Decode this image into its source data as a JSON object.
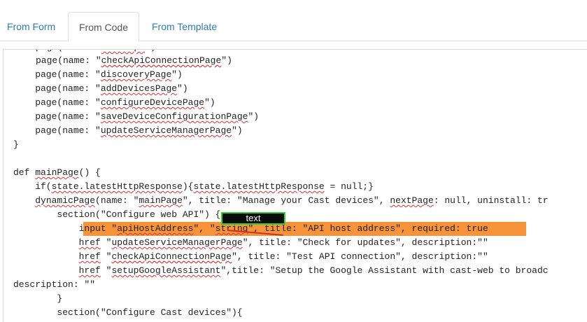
{
  "tabs": [
    {
      "label": "From Form"
    },
    {
      "label": "From Code"
    },
    {
      "label": "From Template"
    }
  ],
  "active_tab": "From Code",
  "code_lines": [
    "page(name: \"checkApiConnectionPage\")",
    "    page(name: \"discoveryPage\")",
    "    page(name: \"addDevicesPage\")",
    "    page(name: \"configureDevicePage\")",
    "    page(name: \"saveDeviceConfigurationPage\")",
    "    page(name: \"updateServiceManagerPage\")",
    "}",
    "",
    "def mainPage() {",
    "    if(state.latestHttpResponse){state.latestHttpResponse = null;}",
    "    dynamicPage(name: \"mainPage\", title: \"Manage your Cast devices\", nextPage: null, uninstall: tr",
    "        section(\"Configure web API\") {",
    "            input \"apiHostAddress\", \"string\", title: \"API host address\", required: true",
    "            href \"updateServiceManagerPage\", title: \"Check for updates\", description:\"\"",
    "            href \"checkApiConnectionPage\", title: \"Test API connection\", description:\"\"",
    "            href \"setupGoogleAssistant\",title: \"Setup the Google Assistant with cast-web to broadc",
    "description: \"\"",
    "        }",
    "        section(\"Configure Cast devices\"){"
  ],
  "annotation": {
    "tag_text": "text",
    "highlight_color": "#f7943b",
    "tag_border_color": "#2ed12e"
  }
}
